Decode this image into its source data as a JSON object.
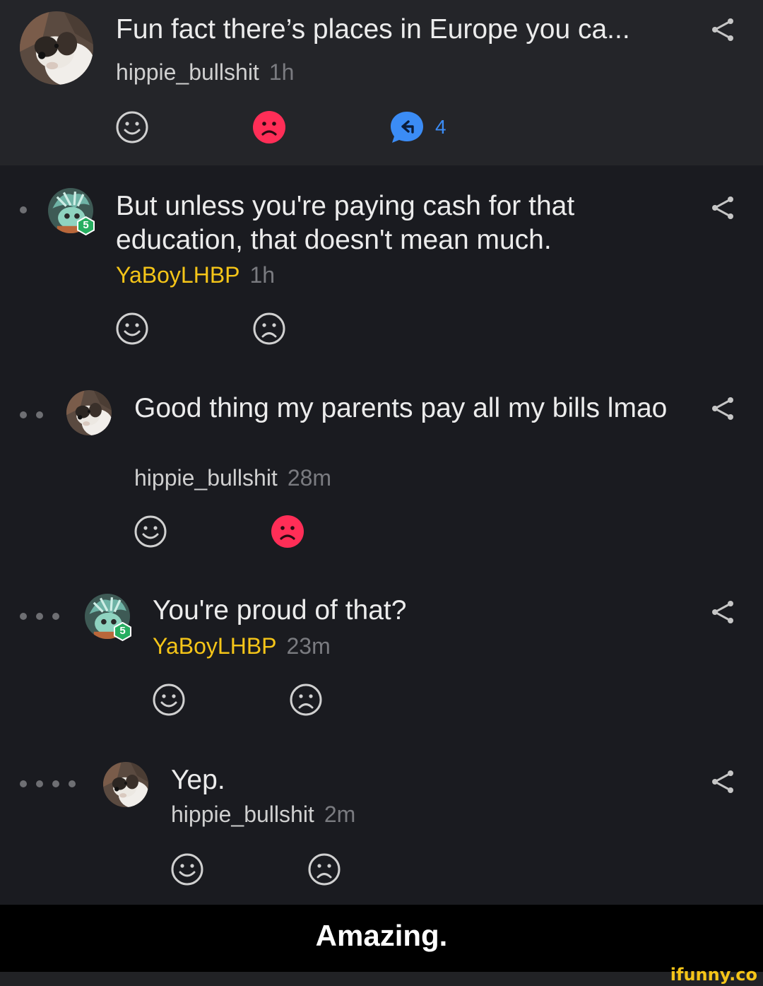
{
  "op": {
    "title": "Fun fact there’s places in Europe you ca...",
    "author": "hippie_bullshit",
    "time": "1h",
    "reply_count": "4"
  },
  "comments": [
    {
      "text": "But unless you're paying cash for that education, that doesn't mean much.",
      "author": "YaBoyLHBP",
      "time": "1h",
      "badge": "5"
    },
    {
      "text": "Good thing my parents pay all my bills lmao",
      "author": "hippie_bullshit",
      "time": "28m"
    },
    {
      "text": "You're proud of that?",
      "author": "YaBoyLHBP",
      "time": "23m",
      "badge": "5"
    },
    {
      "text": "Yep.",
      "author": "hippie_bullshit",
      "time": "2m"
    }
  ],
  "footer": {
    "caption": "Amazing.",
    "watermark": "ifunny.co"
  },
  "icons": {
    "smile": "smile-icon",
    "frown": "frown-icon",
    "reply": "reply-bubble-icon",
    "share": "share-icon"
  },
  "colors": {
    "gold": "#f5c518",
    "frown_active": "#ff2e57",
    "reply_blue": "#3b8cf5",
    "badge_green": "#27ae60"
  }
}
